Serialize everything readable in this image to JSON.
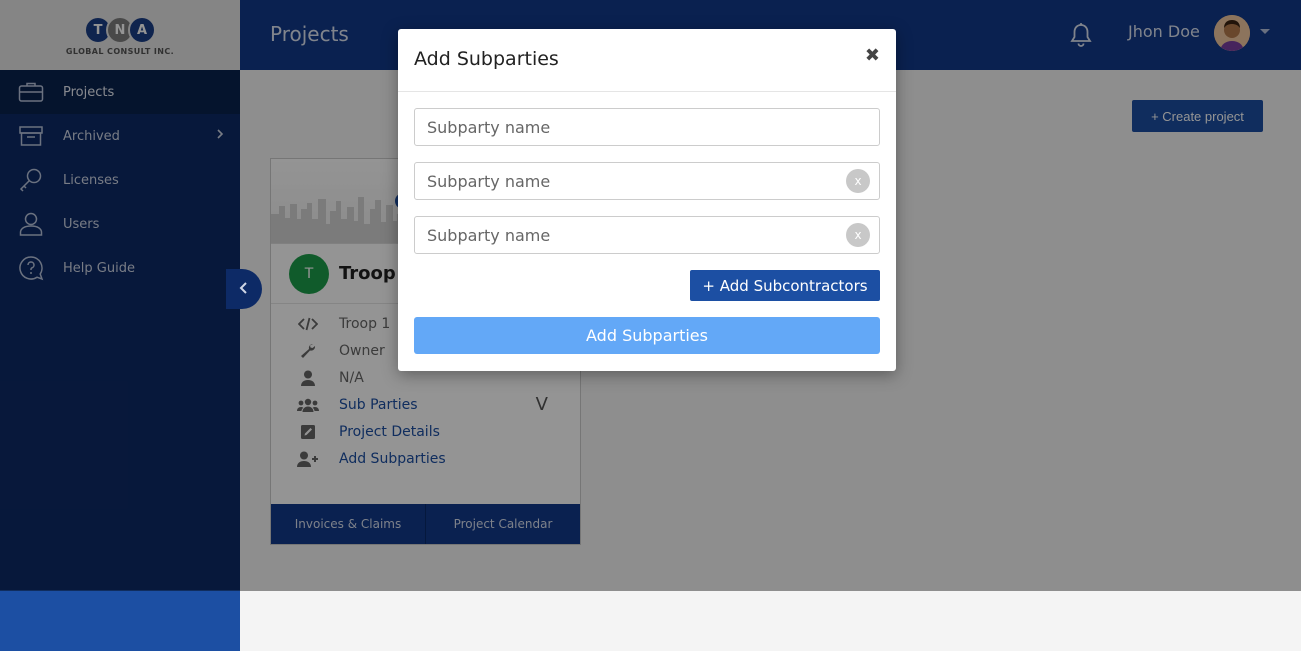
{
  "brand": {
    "letters": [
      "T",
      "N",
      "A"
    ],
    "tagline": "GLOBAL CONSULT INC."
  },
  "sidebar": {
    "items": [
      {
        "label": "Projects",
        "icon": "briefcase-icon"
      },
      {
        "label": "Archived",
        "icon": "archive-box-icon"
      },
      {
        "label": "Licenses",
        "icon": "key-icon"
      },
      {
        "label": "Users",
        "icon": "user-icon"
      },
      {
        "label": "Help Guide",
        "icon": "help-bubble-icon"
      }
    ]
  },
  "header": {
    "title": "Projects",
    "username": "Jhon Doe"
  },
  "main": {
    "create_label": "+ Create project"
  },
  "card": {
    "avatar_letter": "T",
    "name": "Troop 1",
    "rows": [
      {
        "label": "Troop 1",
        "icon": "code-icon"
      },
      {
        "label": "Owner",
        "icon": "wrench-icon"
      },
      {
        "label": "N/A",
        "icon": "person-icon"
      },
      {
        "label": "Sub Parties",
        "icon": "users-group-icon",
        "expander": "V"
      },
      {
        "label": "Project Details",
        "icon": "edit-square-icon"
      },
      {
        "label": "Add Subparties",
        "icon": "user-plus-icon"
      }
    ],
    "footer": [
      "Invoices & Claims",
      "Project Calendar"
    ]
  },
  "modal": {
    "title": "Add Subparties",
    "close": "✖",
    "placeholder": "Subparty name",
    "clear": "x",
    "add_subcontractors_label": "+ Add Subcontractors",
    "submit_label": "Add Subparties"
  },
  "colors": {
    "sidebar": "#0d2a66",
    "header": "#12398a",
    "primary_button": "#1c4fa3",
    "submit_button": "#63a8f7",
    "project_avatar": "#1d9e4a"
  }
}
